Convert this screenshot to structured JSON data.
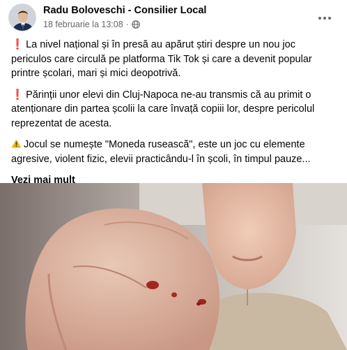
{
  "post": {
    "author": "Radu Boloveschi - Consilier Local",
    "date": "18 februarie la 13:08",
    "separator": "·",
    "privacy_icon": "globe-icon",
    "more_icon": "more-options-icon",
    "paragraphs": [
      {
        "icon": "exclamation-icon",
        "glyph": "❗",
        "text": "La nivel național și în presă au apărut știri despre un nou joc periculos care circulă pe platforma Tik Tok și care a devenit popular printre școlari, mari și mici deopotrivă."
      },
      {
        "icon": "exclamation-icon",
        "glyph": "❗",
        "text": "Părinții unor elevi din Cluj-Napoca ne-au transmis că au primit o atenționare din partea școlii la care învață copiii lor, despre pericolul reprezentat de acesta."
      },
      {
        "icon": "warning-icon",
        "glyph": "",
        "text": "Jocul se numește \"Moneda rusească\", este un joc cu elemente agresive, violent fizic, elevii practicându-l în școli, în timpul pauze..."
      }
    ],
    "see_more": "Vezi mai mult"
  },
  "colors": {
    "text": "#050505",
    "secondary_text": "#65676b",
    "exclamation": "#e0245e",
    "warning": "#f5b800"
  }
}
